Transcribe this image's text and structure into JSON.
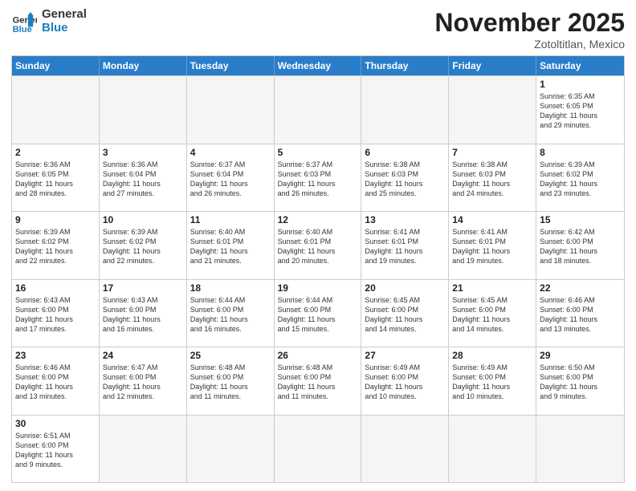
{
  "header": {
    "logo_general": "General",
    "logo_blue": "Blue",
    "title": "November 2025",
    "subtitle": "Zotoltitlan, Mexico"
  },
  "days_of_week": [
    "Sunday",
    "Monday",
    "Tuesday",
    "Wednesday",
    "Thursday",
    "Friday",
    "Saturday"
  ],
  "weeks": [
    [
      {
        "date": "",
        "info": ""
      },
      {
        "date": "",
        "info": ""
      },
      {
        "date": "",
        "info": ""
      },
      {
        "date": "",
        "info": ""
      },
      {
        "date": "",
        "info": ""
      },
      {
        "date": "",
        "info": ""
      },
      {
        "date": "1",
        "info": "Sunrise: 6:35 AM\nSunset: 6:05 PM\nDaylight: 11 hours\nand 29 minutes."
      }
    ],
    [
      {
        "date": "2",
        "info": "Sunrise: 6:36 AM\nSunset: 6:05 PM\nDaylight: 11 hours\nand 28 minutes."
      },
      {
        "date": "3",
        "info": "Sunrise: 6:36 AM\nSunset: 6:04 PM\nDaylight: 11 hours\nand 27 minutes."
      },
      {
        "date": "4",
        "info": "Sunrise: 6:37 AM\nSunset: 6:04 PM\nDaylight: 11 hours\nand 26 minutes."
      },
      {
        "date": "5",
        "info": "Sunrise: 6:37 AM\nSunset: 6:03 PM\nDaylight: 11 hours\nand 26 minutes."
      },
      {
        "date": "6",
        "info": "Sunrise: 6:38 AM\nSunset: 6:03 PM\nDaylight: 11 hours\nand 25 minutes."
      },
      {
        "date": "7",
        "info": "Sunrise: 6:38 AM\nSunset: 6:03 PM\nDaylight: 11 hours\nand 24 minutes."
      },
      {
        "date": "8",
        "info": "Sunrise: 6:39 AM\nSunset: 6:02 PM\nDaylight: 11 hours\nand 23 minutes."
      }
    ],
    [
      {
        "date": "9",
        "info": "Sunrise: 6:39 AM\nSunset: 6:02 PM\nDaylight: 11 hours\nand 22 minutes."
      },
      {
        "date": "10",
        "info": "Sunrise: 6:39 AM\nSunset: 6:02 PM\nDaylight: 11 hours\nand 22 minutes."
      },
      {
        "date": "11",
        "info": "Sunrise: 6:40 AM\nSunset: 6:01 PM\nDaylight: 11 hours\nand 21 minutes."
      },
      {
        "date": "12",
        "info": "Sunrise: 6:40 AM\nSunset: 6:01 PM\nDaylight: 11 hours\nand 20 minutes."
      },
      {
        "date": "13",
        "info": "Sunrise: 6:41 AM\nSunset: 6:01 PM\nDaylight: 11 hours\nand 19 minutes."
      },
      {
        "date": "14",
        "info": "Sunrise: 6:41 AM\nSunset: 6:01 PM\nDaylight: 11 hours\nand 19 minutes."
      },
      {
        "date": "15",
        "info": "Sunrise: 6:42 AM\nSunset: 6:00 PM\nDaylight: 11 hours\nand 18 minutes."
      }
    ],
    [
      {
        "date": "16",
        "info": "Sunrise: 6:43 AM\nSunset: 6:00 PM\nDaylight: 11 hours\nand 17 minutes."
      },
      {
        "date": "17",
        "info": "Sunrise: 6:43 AM\nSunset: 6:00 PM\nDaylight: 11 hours\nand 16 minutes."
      },
      {
        "date": "18",
        "info": "Sunrise: 6:44 AM\nSunset: 6:00 PM\nDaylight: 11 hours\nand 16 minutes."
      },
      {
        "date": "19",
        "info": "Sunrise: 6:44 AM\nSunset: 6:00 PM\nDaylight: 11 hours\nand 15 minutes."
      },
      {
        "date": "20",
        "info": "Sunrise: 6:45 AM\nSunset: 6:00 PM\nDaylight: 11 hours\nand 14 minutes."
      },
      {
        "date": "21",
        "info": "Sunrise: 6:45 AM\nSunset: 6:00 PM\nDaylight: 11 hours\nand 14 minutes."
      },
      {
        "date": "22",
        "info": "Sunrise: 6:46 AM\nSunset: 6:00 PM\nDaylight: 11 hours\nand 13 minutes."
      }
    ],
    [
      {
        "date": "23",
        "info": "Sunrise: 6:46 AM\nSunset: 6:00 PM\nDaylight: 11 hours\nand 13 minutes."
      },
      {
        "date": "24",
        "info": "Sunrise: 6:47 AM\nSunset: 6:00 PM\nDaylight: 11 hours\nand 12 minutes."
      },
      {
        "date": "25",
        "info": "Sunrise: 6:48 AM\nSunset: 6:00 PM\nDaylight: 11 hours\nand 11 minutes."
      },
      {
        "date": "26",
        "info": "Sunrise: 6:48 AM\nSunset: 6:00 PM\nDaylight: 11 hours\nand 11 minutes."
      },
      {
        "date": "27",
        "info": "Sunrise: 6:49 AM\nSunset: 6:00 PM\nDaylight: 11 hours\nand 10 minutes."
      },
      {
        "date": "28",
        "info": "Sunrise: 6:49 AM\nSunset: 6:00 PM\nDaylight: 11 hours\nand 10 minutes."
      },
      {
        "date": "29",
        "info": "Sunrise: 6:50 AM\nSunset: 6:00 PM\nDaylight: 11 hours\nand 9 minutes."
      }
    ],
    [
      {
        "date": "30",
        "info": "Sunrise: 6:51 AM\nSunset: 6:00 PM\nDaylight: 11 hours\nand 9 minutes."
      },
      {
        "date": "",
        "info": ""
      },
      {
        "date": "",
        "info": ""
      },
      {
        "date": "",
        "info": ""
      },
      {
        "date": "",
        "info": ""
      },
      {
        "date": "",
        "info": ""
      },
      {
        "date": "",
        "info": ""
      }
    ]
  ]
}
